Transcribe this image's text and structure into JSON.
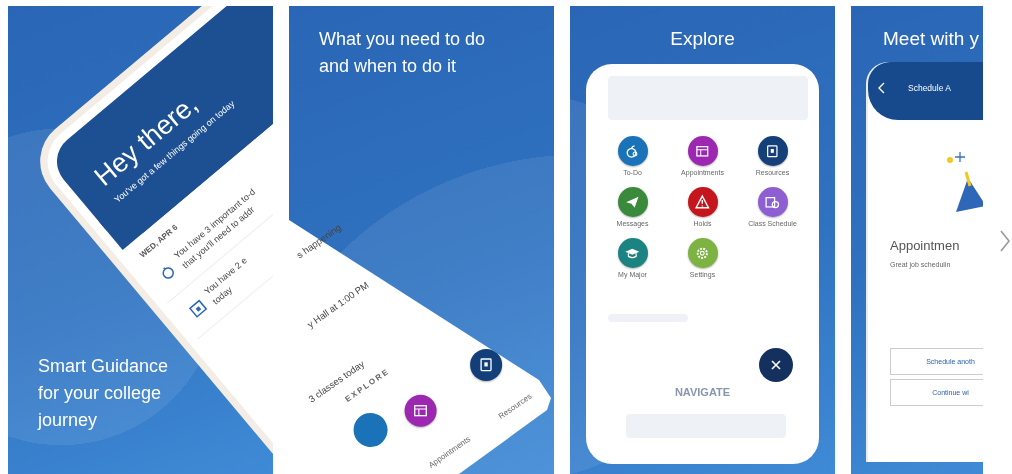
{
  "screenshots": [
    {
      "caption": "Smart Guidance for your college journey",
      "phone": {
        "greeting": "Hey there,",
        "subtitle": "You've got a few things going on today",
        "date": "WED, APR 6",
        "items": [
          {
            "lines": [
              "You have 3 important to-d",
              "that you'll need to addr"
            ]
          },
          {
            "lines": [
              "You have 2 e",
              "today"
            ]
          }
        ]
      }
    },
    {
      "caption": "What you need to do and when to do it",
      "phone": {
        "items": [
          {
            "text": "s happening"
          },
          {
            "text": "y Hall at 1:00 PM"
          },
          {
            "text": "3 classes today"
          }
        ],
        "section": "EXPLORE",
        "tiles": [
          {
            "label": "Appointments",
            "color": "#9c27b0"
          },
          {
            "label": "Resources",
            "color": "#123f7a"
          }
        ]
      }
    },
    {
      "title": "Explore",
      "tiles": [
        {
          "label": "To-Do",
          "color": "#1a72b8"
        },
        {
          "label": "Appointments",
          "color": "#9c27b0"
        },
        {
          "label": "Resources",
          "color": "#143f78"
        },
        {
          "label": "Messages",
          "color": "#3a8a3c"
        },
        {
          "label": "Holds",
          "color": "#c4161c"
        },
        {
          "label": "Class Schedule",
          "color": "#8d5fd3"
        },
        {
          "label": "My Major",
          "color": "#1b8382"
        },
        {
          "label": "Settings",
          "color": "#7cb342"
        }
      ],
      "footer": "NAVIGATE"
    },
    {
      "title": "Meet with y",
      "header": "Schedule A",
      "heading": "Appointmen",
      "message": "Great job schedulin",
      "buttons": [
        "Schedule anoth",
        "Continue wi"
      ]
    }
  ]
}
